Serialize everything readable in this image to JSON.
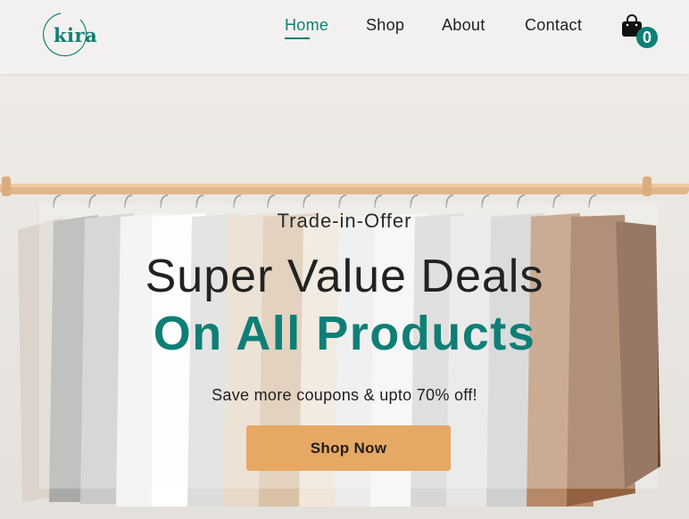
{
  "brand": {
    "logo_text": "kira",
    "accent": "#0f7f76"
  },
  "nav": {
    "items": [
      {
        "label": "Home",
        "active": true
      },
      {
        "label": "Shop",
        "active": false
      },
      {
        "label": "About",
        "active": false
      },
      {
        "label": "Contact",
        "active": false
      }
    ]
  },
  "cart": {
    "icon": "shopping-bag-icon",
    "count": "0"
  },
  "hero": {
    "eyebrow": "Trade-in-Offer",
    "headline": "Super Value Deals",
    "headline_accent": "On All Products",
    "subtext": "Save more coupons & upto 70% off!",
    "cta_label": "Shop Now",
    "cta_color": "#e7a863"
  }
}
